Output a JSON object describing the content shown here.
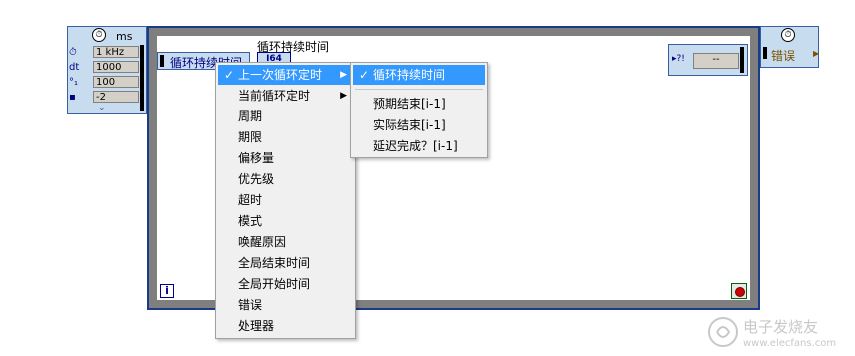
{
  "left_node": {
    "unit": "ms",
    "rows": [
      {
        "label": "⏱",
        "value": "1 kHz"
      },
      {
        "label": "dt",
        "value": "1000"
      },
      {
        "label": "°₁",
        "value": "100"
      },
      {
        "label": "▪",
        "value": "-2"
      }
    ]
  },
  "loop": {
    "title": "循环持续时间",
    "left_data_label": "循环持续时间",
    "data_type": "I64",
    "error_value": "--",
    "iteration_label": "i"
  },
  "right_node": {
    "label": "错误"
  },
  "menu1": {
    "items": [
      {
        "label": "上一次循环定时",
        "checked": true,
        "submenu": true,
        "highlighted": true
      },
      {
        "label": "当前循环定时",
        "checked": false,
        "submenu": true
      },
      {
        "label": "周期"
      },
      {
        "label": "期限"
      },
      {
        "label": "偏移量"
      },
      {
        "label": "优先级"
      },
      {
        "label": "超时"
      },
      {
        "label": "模式"
      },
      {
        "label": "唤醒原因"
      },
      {
        "label": "全局结束时间"
      },
      {
        "label": "全局开始时间"
      },
      {
        "label": "错误"
      },
      {
        "label": "处理器"
      }
    ]
  },
  "menu2": {
    "items": [
      {
        "label": "循环持续时间",
        "checked": true,
        "highlighted": true
      },
      {
        "label": "预期结束[i-1]"
      },
      {
        "label": "实际结束[i-1]"
      },
      {
        "label": "延迟完成？[i-1]"
      }
    ]
  },
  "watermark": "电子发烧友 www.elecfans.com"
}
